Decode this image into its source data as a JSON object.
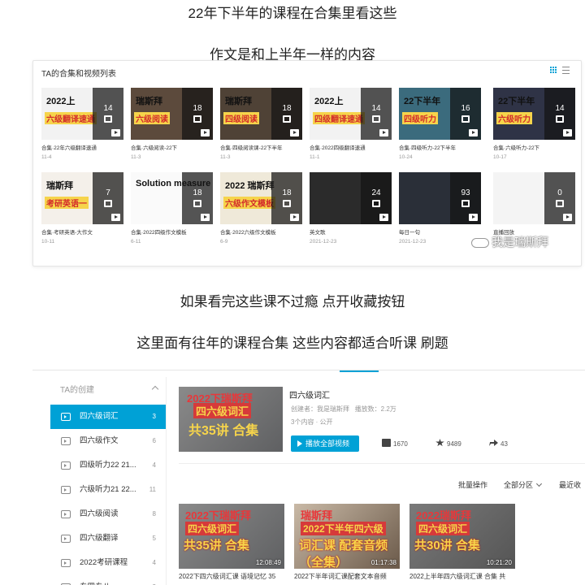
{
  "captions": [
    "22年下半年的课程在合集里看这些",
    "作文是和上半年一样的内容",
    "如果看完这些课不过瘾 点开收藏按钮",
    "这里面有往年的课程合集 这些内容都适合听课 刷题"
  ],
  "panel1": {
    "title": "TA的合集和视频列表",
    "cards": [
      {
        "thumb_a": "2022上",
        "thumb_b": "六级翻译速通",
        "count": "14",
        "title": "合集·22年六级翻译速通",
        "date": "11-4",
        "bg": "#f2f2f2"
      },
      {
        "thumb_a": "瑞斯拜",
        "thumb_b": "六级阅读",
        "count": "18",
        "title": "合集·六级阅读-22下",
        "date": "11-3",
        "bg": "#5c4a3c"
      },
      {
        "thumb_a": "瑞斯拜",
        "thumb_b": "四级阅读",
        "count": "18",
        "title": "合集·四级阅读课-22下半年",
        "date": "11-3",
        "bg": "#4f4236"
      },
      {
        "thumb_a": "2022上",
        "thumb_b": "四级翻译速通",
        "count": "14",
        "title": "合集·2022四级翻译速通",
        "date": "11-1",
        "bg": "#f2f2f2"
      },
      {
        "thumb_a": "22下半年",
        "thumb_b": "四级听力",
        "count": "16",
        "title": "合集·四级听力-22下半年",
        "date": "10-24",
        "bg": "#3b6b7d"
      },
      {
        "thumb_a": "22下半年",
        "thumb_b": "六级听力",
        "count": "14",
        "title": "合集·六级听力-22下",
        "date": "10-17",
        "bg": "#2f3346"
      },
      {
        "thumb_a": "瑞斯拜",
        "thumb_b": "考研英语一",
        "count": "7",
        "title": "合集·考研英语-大作文",
        "date": "10-11",
        "bg": "#f4f0ea"
      },
      {
        "thumb_a": "Solution measure",
        "thumb_b": "",
        "count": "18",
        "title": "合集·2022四级作文模板",
        "date": "6-11",
        "bg": "#fafafa"
      },
      {
        "thumb_a": "2022 瑞斯拜",
        "thumb_b": "六级作文模板",
        "count": "18",
        "title": "合集·2022六级作文模板",
        "date": "6-9",
        "bg": "#efe9d9"
      },
      {
        "thumb_a": "",
        "thumb_b": "",
        "count": "24",
        "title": "英文歌",
        "date": "2021-12-23",
        "bg": "#2b2b2b"
      },
      {
        "thumb_a": "",
        "thumb_b": "",
        "count": "93",
        "title": "每日一句",
        "date": "2021-12-23",
        "bg": "#2a2f38"
      },
      {
        "thumb_a": "",
        "thumb_b": "",
        "count": "0",
        "title": "直播回放",
        "date": "",
        "bg": "#f4f4f4"
      }
    ],
    "watermark": "我是瑞斯拜"
  },
  "panel2": {
    "sidebar_header": "TA的创建",
    "sidebar_items": [
      {
        "label": "四六级词汇",
        "count": "3"
      },
      {
        "label": "四六级作文",
        "count": "6"
      },
      {
        "label": "四级听力22 21...",
        "count": "4"
      },
      {
        "label": "六级听力21 22...",
        "count": "11"
      },
      {
        "label": "四六级阅读",
        "count": "8"
      },
      {
        "label": "四六级翻译",
        "count": "5"
      },
      {
        "label": "2022考研课程",
        "count": "4"
      },
      {
        "label": "专四专八",
        "count": "3"
      }
    ],
    "featured": {
      "thumb_l1": "2022下瑞斯拜",
      "thumb_l2": "四六级词汇",
      "thumb_l3": "共35讲 合集",
      "name": "四六级词汇",
      "creator": "创建者：我是瑞斯拜",
      "plays": "播放数：2.2万",
      "meta2": "3个内容 · 公开",
      "play_all": "播放全部视频",
      "likes": "1670",
      "favorites": "9489",
      "shares": "43"
    },
    "toolbar": {
      "batch": "批量操作",
      "all_sections": "全部分区",
      "sort": "最近收"
    },
    "videos": [
      {
        "l1": "2022下瑞斯拜",
        "l2": "四六级词汇",
        "l3": "共35讲 合集",
        "duration": "12:08:49",
        "title": "2022下四六级词汇课 语境记忆 35"
      },
      {
        "l1": "瑞斯拜",
        "l2": "2022下半年四六级",
        "l3": "词汇课 配套音频（全集）",
        "duration": "01:17:38",
        "title": "2022下半年词汇课配套文本音频"
      },
      {
        "l1": "2022瑞斯拜",
        "l2": "四六级词汇",
        "l3": "共30讲 合集",
        "duration": "10:21:20",
        "title": "2022上半年四六级词汇课 合集 共"
      }
    ]
  }
}
